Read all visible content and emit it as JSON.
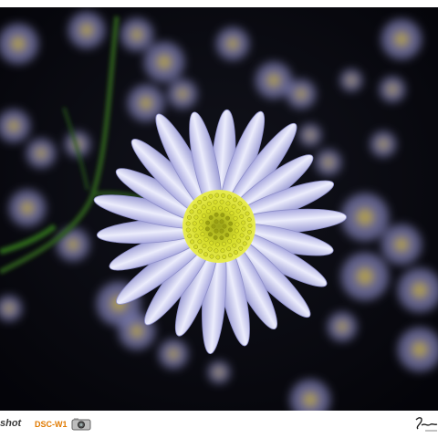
{
  "photo": {
    "subject": "daisy-flower-icon",
    "colors": {
      "background": "#06070c",
      "petal": "#d9dcf5",
      "petal_shadow": "#8e8fc9",
      "center": "#d8de2a",
      "center_dark": "#9aa012",
      "stem": "#2f6a1e"
    }
  },
  "footer": {
    "brand_fragment": "shot",
    "model_label": "DSC-W1",
    "camera_icon": "camera-icon",
    "signature_icon": "signature-icon"
  }
}
